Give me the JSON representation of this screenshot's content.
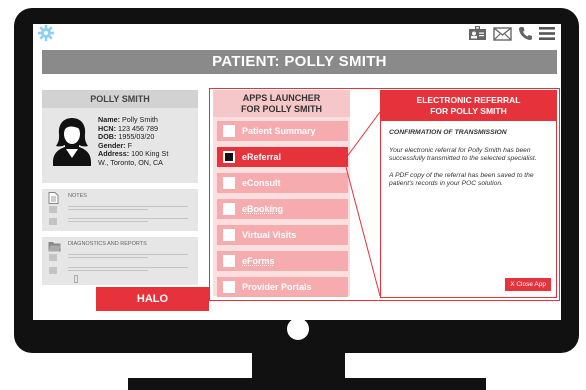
{
  "header": {
    "title": "PATIENT: POLLY SMITH"
  },
  "icons": {
    "settings": "gear-icon",
    "contact_card": "contact-card-icon",
    "mail": "mail-icon",
    "phone": "phone-icon",
    "menu": "hamburger-menu-icon"
  },
  "patient": {
    "name_heading": "POLLY SMITH",
    "name_label": "Name:",
    "name": "Polly Smith",
    "hcn_label": "HCN:",
    "hcn": "123 456 789",
    "dob_label": "DOB:",
    "dob": "1955/03/20",
    "gender_label": "Gender:",
    "gender": "F",
    "address_label": "Address:",
    "address_line1": "100 King St",
    "address_line2": "W., Toronto, ON, CA"
  },
  "sections": {
    "notes": "NOTES",
    "diagnostics": "DIAGNOSTICS AND REPORTS"
  },
  "halo_button": "HALO",
  "launcher": {
    "title_line1": "APPS LAUNCHER",
    "title_line2": "FOR POLLY SMITH",
    "apps": [
      {
        "label": "Patient Summary"
      },
      {
        "label": "eReferral"
      },
      {
        "label": "eConsult"
      },
      {
        "label": "eBooking"
      },
      {
        "label": "Virtual Visits"
      },
      {
        "label": "eForms"
      },
      {
        "label": "Provider Portals"
      }
    ]
  },
  "referral": {
    "title_line1": "ELECTRONIC REFERRAL",
    "title_line2": "FOR POLLY SMITH",
    "confirmation": "CONFIRMATION OF TRANSMISSION",
    "message1": "Your electronic referral for Polly Smith has been successfully transmitted to the selected specialist.",
    "message2": "A PDF copy of the referral has been saved to the patient's records in your POC solution.",
    "close_label": "X Close App"
  },
  "colors": {
    "accent": "#e5323b",
    "title_bar": "#8a8a8a",
    "panel_gray": "#e6e6e6",
    "launcher_bg": "#fbdede",
    "app_item": "#f6abaf"
  }
}
